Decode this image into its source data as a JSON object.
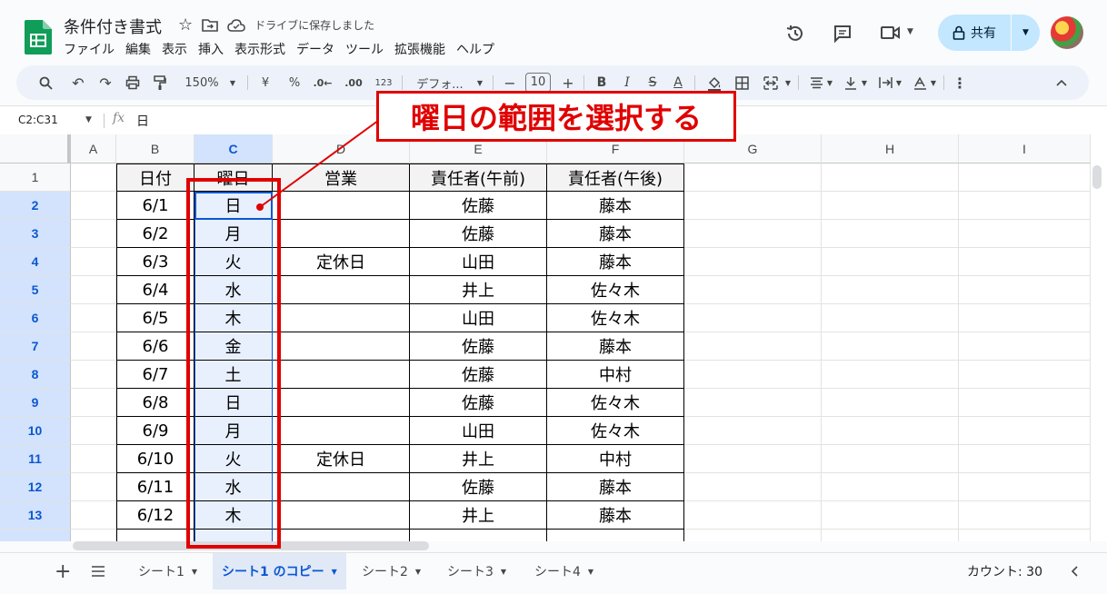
{
  "header": {
    "title": "条件付き書式",
    "saved_status": "ドライブに保存しました",
    "menus": [
      "ファイル",
      "編集",
      "表示",
      "挿入",
      "表示形式",
      "データ",
      "ツール",
      "拡張機能",
      "ヘルプ"
    ],
    "share_label": "共有"
  },
  "toolbar": {
    "zoom": "150%",
    "currency": "¥",
    "percent": "%",
    "dec_less": ".0←",
    "dec_more": ".00",
    "format_123": "123",
    "font": "デフォ...",
    "minus": "−",
    "font_size": "10",
    "plus": "+",
    "bold": "B",
    "italic": "I",
    "strike": "S",
    "text_color": "A",
    "more": "⋮",
    "collapse": "^"
  },
  "formula_bar": {
    "name_box": "C2:C31",
    "fx": "fx",
    "value": "日"
  },
  "columns": [
    "A",
    "B",
    "C",
    "D",
    "E",
    "F",
    "G",
    "H",
    "I"
  ],
  "selected_column": "C",
  "rows": [
    {
      "n": "1",
      "b": "日付",
      "c": "曜日",
      "d": "営業",
      "e": "責任者(午前)",
      "f": "責任者(午後)"
    },
    {
      "n": "2",
      "b": "6/1",
      "c": "日",
      "d": "",
      "e": "佐藤",
      "f": "藤本"
    },
    {
      "n": "3",
      "b": "6/2",
      "c": "月",
      "d": "",
      "e": "佐藤",
      "f": "藤本"
    },
    {
      "n": "4",
      "b": "6/3",
      "c": "火",
      "d": "定休日",
      "e": "山田",
      "f": "藤本"
    },
    {
      "n": "5",
      "b": "6/4",
      "c": "水",
      "d": "",
      "e": "井上",
      "f": "佐々木"
    },
    {
      "n": "6",
      "b": "6/5",
      "c": "木",
      "d": "",
      "e": "山田",
      "f": "佐々木"
    },
    {
      "n": "7",
      "b": "6/6",
      "c": "金",
      "d": "",
      "e": "佐藤",
      "f": "藤本"
    },
    {
      "n": "8",
      "b": "6/7",
      "c": "土",
      "d": "",
      "e": "佐藤",
      "f": "中村"
    },
    {
      "n": "9",
      "b": "6/8",
      "c": "日",
      "d": "",
      "e": "佐藤",
      "f": "佐々木"
    },
    {
      "n": "10",
      "b": "6/9",
      "c": "月",
      "d": "",
      "e": "山田",
      "f": "佐々木"
    },
    {
      "n": "11",
      "b": "6/10",
      "c": "火",
      "d": "定休日",
      "e": "井上",
      "f": "中村"
    },
    {
      "n": "12",
      "b": "6/11",
      "c": "水",
      "d": "",
      "e": "佐藤",
      "f": "藤本"
    },
    {
      "n": "13",
      "b": "6/12",
      "c": "木",
      "d": "",
      "e": "井上",
      "f": "藤本"
    }
  ],
  "annotation": {
    "callout_text": "曜日の範囲を選択する",
    "color": "#e00000"
  },
  "sheet_tabs": [
    "シート1",
    "シート1 のコピー",
    "シート2",
    "シート3",
    "シート4"
  ],
  "active_sheet": "シート1 のコピー",
  "status": {
    "count": "カウント: 30"
  },
  "colors": {
    "selection": "#d3e3fd",
    "accent": "#0b57d0",
    "share_bg": "#c2e7ff",
    "sheets_green": "#0f9d58"
  }
}
